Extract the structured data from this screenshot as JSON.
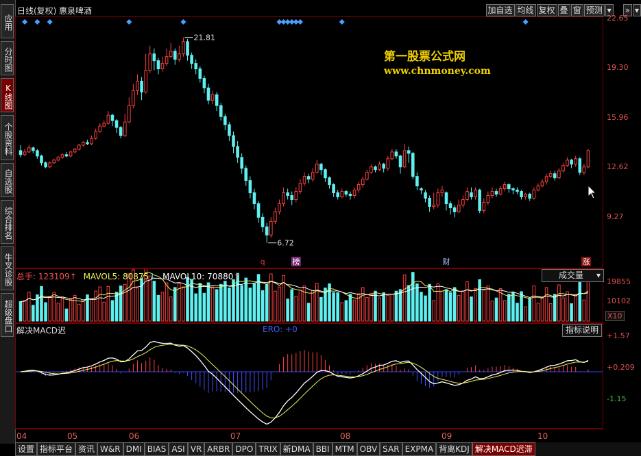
{
  "sidebar": {
    "tabs": [
      {
        "label": "应用",
        "active": false
      },
      {
        "label": "分时图",
        "active": false
      },
      {
        "label": "K线图",
        "active": true
      },
      {
        "label": "个股资料",
        "active": false
      },
      {
        "label": "自选股",
        "active": false
      },
      {
        "label": "综合排名",
        "active": false
      },
      {
        "label": "牛叉诊股",
        "active": false
      },
      {
        "label": "超级盘口",
        "active": false
      }
    ]
  },
  "header": {
    "period": "日线(复权)",
    "stock_name": "惠泉啤酒",
    "buttons": [
      "加自选",
      "均线",
      "复权",
      "叠",
      "窗",
      "预测"
    ],
    "more_icon": "chevron-down-icon",
    "nav_icon": "double-arrow-icon"
  },
  "watermark": {
    "line1": "第一股票公式网",
    "line2": "www.chnmoney.com"
  },
  "price_axis": [
    "22.65",
    "19.30",
    "15.96",
    "12.62",
    "9.27"
  ],
  "price_annotations": {
    "high": "21.81",
    "low": "6.72"
  },
  "event_markers": [
    {
      "label": "q",
      "color": "#e04040"
    },
    {
      "label": "榜",
      "color": "#ffffff",
      "bg": "#7a2a7a"
    },
    {
      "label": "财",
      "color": "#a0c8ff"
    },
    {
      "label": "涨",
      "color": "#ffffff",
      "bg": "#8a1010"
    }
  ],
  "volume": {
    "total_label": "总手:",
    "total_value": "123109",
    "mavol5_label": "MAVOL5:",
    "mavol5_value": "80875",
    "mavol10_label": "MAVOL10:",
    "mavol10_value": "70880",
    "selector": "成交量",
    "axis": [
      "19855",
      "10102"
    ],
    "unit": "X10"
  },
  "macd": {
    "title": "解决MACD迟",
    "ero_label": "ERO:",
    "ero_value": "+0",
    "help_button": "指标说明",
    "axis": [
      "+1.57",
      "+0.209",
      "-1.15"
    ]
  },
  "date_axis": [
    "04",
    "05",
    "06",
    "07",
    "08",
    "09",
    "10"
  ],
  "bottom_tabs": [
    {
      "label": "设置",
      "active": false
    },
    {
      "label": "指标平台",
      "active": false
    },
    {
      "label": "资讯",
      "active": false
    },
    {
      "label": "W&R",
      "active": false
    },
    {
      "label": "DMI",
      "active": false
    },
    {
      "label": "BIAS",
      "active": false
    },
    {
      "label": "ASI",
      "active": false
    },
    {
      "label": "VR",
      "active": false
    },
    {
      "label": "ARBR",
      "active": false
    },
    {
      "label": "DPO",
      "active": false
    },
    {
      "label": "TRIX",
      "active": false
    },
    {
      "label": "新DMA",
      "active": false
    },
    {
      "label": "BBI",
      "active": false
    },
    {
      "label": "MTM",
      "active": false
    },
    {
      "label": "OBV",
      "active": false
    },
    {
      "label": "SAR",
      "active": false
    },
    {
      "label": "EXPMA",
      "active": false
    },
    {
      "label": "背离KDJ",
      "active": false
    },
    {
      "label": "解决MACD迟滞",
      "active": true
    }
  ],
  "colors": {
    "up": "#ff4040",
    "down": "#5ff0f0",
    "frame": "#7a0000",
    "diamond": "#4aa0ff"
  },
  "chart_data": {
    "type": "candlestick",
    "candles": [
      [
        13.5,
        13.2,
        13.9,
        13.0
      ],
      [
        13.2,
        13.4,
        13.6,
        13.1
      ],
      [
        13.4,
        13.7,
        13.9,
        13.3
      ],
      [
        13.7,
        13.5,
        13.8,
        13.3
      ],
      [
        13.5,
        13.1,
        13.6,
        12.9
      ],
      [
        13.1,
        12.6,
        13.2,
        12.4
      ],
      [
        12.6,
        12.3,
        12.7,
        12.2
      ],
      [
        12.3,
        12.6,
        12.7,
        12.2
      ],
      [
        12.6,
        12.8,
        12.9,
        12.5
      ],
      [
        12.8,
        13.0,
        13.1,
        12.7
      ],
      [
        13.0,
        13.2,
        13.3,
        12.9
      ],
      [
        13.2,
        13.1,
        13.4,
        13.0
      ],
      [
        13.1,
        13.4,
        13.5,
        13.0
      ],
      [
        13.4,
        13.6,
        13.7,
        13.3
      ],
      [
        13.6,
        13.9,
        14.0,
        13.5
      ],
      [
        13.9,
        14.1,
        14.2,
        13.8
      ],
      [
        14.1,
        14.0,
        14.3,
        13.9
      ],
      [
        14.0,
        14.4,
        14.6,
        13.9
      ],
      [
        14.4,
        14.9,
        15.1,
        14.3
      ],
      [
        14.9,
        15.3,
        15.5,
        14.8
      ],
      [
        15.3,
        15.5,
        15.7,
        15.2
      ],
      [
        15.5,
        16.1,
        16.4,
        15.4
      ],
      [
        16.1,
        15.7,
        16.2,
        15.3
      ],
      [
        15.7,
        15.2,
        15.8,
        14.8
      ],
      [
        15.2,
        14.6,
        15.3,
        14.4
      ],
      [
        14.6,
        15.6,
        16.2,
        14.5
      ],
      [
        15.6,
        16.8,
        17.4,
        15.5
      ],
      [
        16.8,
        17.9,
        18.4,
        16.6
      ],
      [
        17.9,
        18.6,
        19.1,
        17.6
      ],
      [
        18.6,
        17.8,
        18.9,
        17.2
      ],
      [
        17.8,
        19.4,
        20.6,
        17.7
      ],
      [
        19.4,
        20.6,
        21.2,
        19.2
      ],
      [
        20.6,
        20.1,
        21.0,
        19.4
      ],
      [
        20.1,
        19.5,
        20.3,
        19.1
      ],
      [
        19.5,
        19.9,
        20.4,
        19.3
      ],
      [
        19.9,
        20.4,
        21.0,
        19.7
      ],
      [
        20.4,
        20.8,
        21.4,
        20.3
      ],
      [
        20.8,
        20.2,
        21.0,
        19.8
      ],
      [
        20.2,
        20.6,
        21.2,
        20.0
      ],
      [
        20.6,
        21.5,
        21.81,
        20.4
      ],
      [
        21.5,
        20.5,
        21.7,
        20.1
      ],
      [
        20.5,
        19.9,
        20.7,
        19.5
      ],
      [
        19.9,
        19.5,
        20.2,
        19.1
      ],
      [
        19.5,
        18.8,
        19.7,
        18.5
      ],
      [
        18.8,
        18.1,
        19.0,
        17.7
      ],
      [
        18.1,
        17.2,
        18.4,
        16.9
      ],
      [
        17.2,
        17.6,
        17.9,
        16.9
      ],
      [
        17.6,
        16.8,
        17.8,
        16.4
      ],
      [
        16.8,
        16.0,
        17.0,
        15.7
      ],
      [
        16.0,
        15.4,
        16.2,
        15.0
      ],
      [
        15.4,
        14.6,
        15.6,
        14.2
      ],
      [
        14.6,
        13.8,
        14.9,
        13.3
      ],
      [
        13.8,
        13.0,
        14.2,
        12.6
      ],
      [
        13.0,
        12.2,
        13.3,
        11.8
      ],
      [
        12.2,
        11.3,
        12.4,
        10.9
      ],
      [
        11.3,
        10.4,
        11.6,
        10.0
      ],
      [
        10.4,
        9.6,
        10.7,
        9.2
      ],
      [
        9.6,
        8.6,
        9.8,
        8.2
      ],
      [
        8.6,
        7.9,
        8.9,
        7.5
      ],
      [
        7.9,
        7.3,
        8.2,
        6.72
      ],
      [
        7.3,
        8.3,
        8.6,
        7.1
      ],
      [
        8.3,
        9.0,
        9.3,
        8.1
      ],
      [
        9.0,
        9.6,
        9.9,
        8.8
      ],
      [
        9.6,
        10.4,
        10.8,
        9.4
      ],
      [
        10.4,
        10.2,
        10.7,
        9.9
      ],
      [
        10.2,
        9.9,
        10.5,
        9.5
      ],
      [
        9.9,
        10.5,
        10.8,
        9.7
      ],
      [
        10.5,
        11.1,
        11.4,
        10.3
      ],
      [
        11.1,
        11.6,
        11.9,
        10.9
      ],
      [
        11.6,
        11.4,
        11.8,
        11.1
      ],
      [
        11.4,
        11.9,
        12.2,
        11.2
      ],
      [
        11.9,
        12.5,
        12.8,
        11.8
      ],
      [
        12.5,
        12.1,
        12.6,
        11.7
      ],
      [
        12.1,
        11.5,
        12.2,
        11.2
      ],
      [
        11.5,
        11.0,
        11.6,
        10.7
      ],
      [
        11.0,
        10.4,
        11.1,
        10.1
      ],
      [
        10.4,
        10.1,
        10.6,
        9.9
      ],
      [
        10.1,
        10.5,
        10.7,
        10.0
      ],
      [
        10.5,
        10.3,
        10.6,
        10.1
      ],
      [
        10.3,
        10.2,
        10.5,
        9.9
      ],
      [
        10.2,
        10.6,
        10.8,
        10.0
      ],
      [
        10.6,
        11.0,
        11.2,
        10.4
      ],
      [
        11.0,
        11.4,
        11.6,
        10.8
      ],
      [
        11.4,
        11.9,
        12.1,
        11.3
      ],
      [
        11.9,
        12.3,
        12.5,
        11.8
      ],
      [
        12.3,
        12.1,
        12.4,
        11.9
      ],
      [
        12.1,
        12.5,
        12.7,
        12.0
      ],
      [
        12.5,
        12.2,
        12.6,
        11.9
      ],
      [
        12.2,
        12.9,
        13.1,
        12.0
      ],
      [
        12.9,
        13.4,
        13.6,
        12.8
      ],
      [
        13.4,
        13.1,
        13.6,
        12.9
      ],
      [
        13.1,
        12.3,
        13.2,
        11.8
      ],
      [
        12.3,
        13.5,
        14.0,
        12.2
      ],
      [
        13.5,
        13.3,
        13.8,
        12.6
      ],
      [
        13.3,
        11.6,
        13.4,
        11.4
      ],
      [
        11.6,
        10.9,
        11.9,
        10.6
      ],
      [
        10.7,
        10.6,
        10.8,
        10.3
      ],
      [
        10.4,
        10.0,
        10.6,
        9.7
      ],
      [
        10.0,
        9.4,
        10.2,
        9.0
      ],
      [
        9.4,
        9.5,
        10.4,
        9.2
      ],
      [
        9.5,
        10.4,
        10.7,
        9.3
      ],
      [
        10.4,
        10.6,
        10.9,
        10.1
      ],
      [
        10.4,
        9.6,
        10.5,
        9.1
      ],
      [
        9.6,
        9.3,
        9.8,
        8.8
      ],
      [
        9.3,
        9.0,
        9.5,
        8.6
      ],
      [
        9.0,
        9.5,
        9.9,
        8.9
      ],
      [
        9.5,
        9.9,
        10.2,
        9.3
      ],
      [
        9.9,
        10.5,
        10.8,
        9.8
      ],
      [
        10.4,
        10.1,
        10.8,
        9.9
      ],
      [
        10.1,
        10.6,
        10.8,
        9.9
      ],
      [
        10.6,
        9.1,
        10.7,
        8.9
      ],
      [
        9.1,
        9.7,
        10.0,
        8.9
      ],
      [
        9.7,
        10.2,
        10.5,
        9.5
      ],
      [
        10.2,
        10.5,
        10.8,
        10.0
      ],
      [
        10.5,
        10.3,
        10.7,
        10.1
      ],
      [
        10.3,
        10.7,
        10.9,
        10.2
      ],
      [
        10.7,
        11.0,
        11.2,
        10.5
      ],
      [
        11.0,
        10.7,
        11.1,
        10.4
      ],
      [
        10.7,
        10.6,
        10.8,
        10.3
      ],
      [
        10.6,
        10.5,
        10.8,
        10.3
      ],
      [
        10.5,
        10.1,
        10.6,
        9.9
      ],
      [
        10.1,
        10.3,
        10.4,
        9.9
      ],
      [
        10.3,
        10.0,
        10.4,
        9.8
      ],
      [
        10.0,
        10.6,
        10.8,
        9.9
      ],
      [
        10.6,
        10.9,
        11.1,
        10.5
      ],
      [
        10.9,
        11.2,
        11.4,
        10.8
      ],
      [
        11.2,
        11.6,
        11.8,
        11.0
      ],
      [
        11.6,
        11.8,
        12.0,
        11.5
      ],
      [
        11.8,
        11.5,
        12.0,
        11.3
      ],
      [
        11.5,
        12.0,
        12.2,
        11.4
      ],
      [
        12.0,
        12.4,
        12.6,
        11.9
      ],
      [
        12.4,
        12.8,
        13.0,
        12.3
      ],
      [
        12.8,
        12.5,
        12.9,
        12.2
      ],
      [
        12.5,
        12.9,
        13.1,
        12.3
      ],
      [
        12.9,
        11.9,
        13.0,
        11.7
      ],
      [
        11.9,
        12.3,
        12.5,
        11.7
      ],
      [
        12.3,
        13.5,
        13.6,
        12.2
      ]
    ],
    "volume_axis": [
      0,
      22000
    ]
  }
}
